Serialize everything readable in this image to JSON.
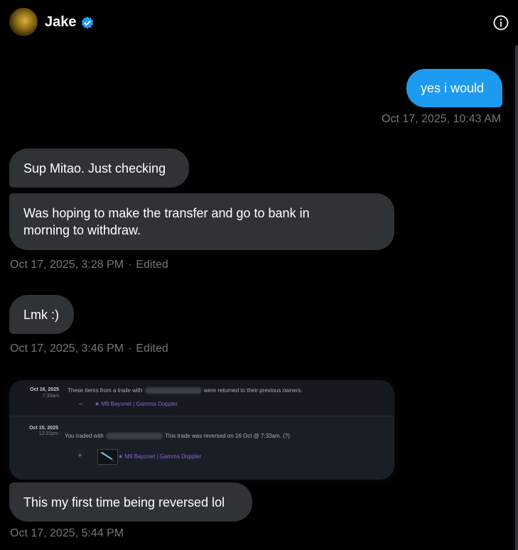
{
  "header": {
    "name": "Jake"
  },
  "messages": [
    {
      "text": "yes i would",
      "meta": "Oct 17, 2025, 10:43 AM"
    },
    {
      "text": "Sup Mitao. Just checking"
    },
    {
      "text": "Was hoping to make the transfer and go to bank in morning to withdraw.",
      "meta": "Oct 17, 2025, 3:28 PM",
      "edited": "Edited"
    },
    {
      "text": "Lmk :)",
      "meta": "Oct 17, 2025, 3:46 PM",
      "edited": "Edited"
    },
    {
      "text": "This my first time being reversed lol",
      "meta": "Oct 17, 2025, 5:44 PM"
    }
  ],
  "card": {
    "rows": [
      {
        "date": "Oct 16, 2025",
        "time": "7:33am",
        "text_before": "These items from a trade with",
        "text_after": "were returned to their previous owners.",
        "symbol": "–",
        "item": "★ M9 Bayonet | Gamma Doppler"
      },
      {
        "date": "Oct 15, 2025",
        "time": "12:31pm",
        "text_before": "You traded with",
        "text_after": "This trade was reversed on 16 Oct @ 7:33am. (?)",
        "symbol": "+",
        "item": "★ M9 Bayonet | Gamma Doppler"
      }
    ]
  },
  "colors": {
    "outgoing": "#1d9bf0",
    "incoming": "#2f3336",
    "meta": "#71767b",
    "item": "#8a63d2"
  },
  "icons": [
    "verified-badge-icon",
    "info-icon"
  ]
}
